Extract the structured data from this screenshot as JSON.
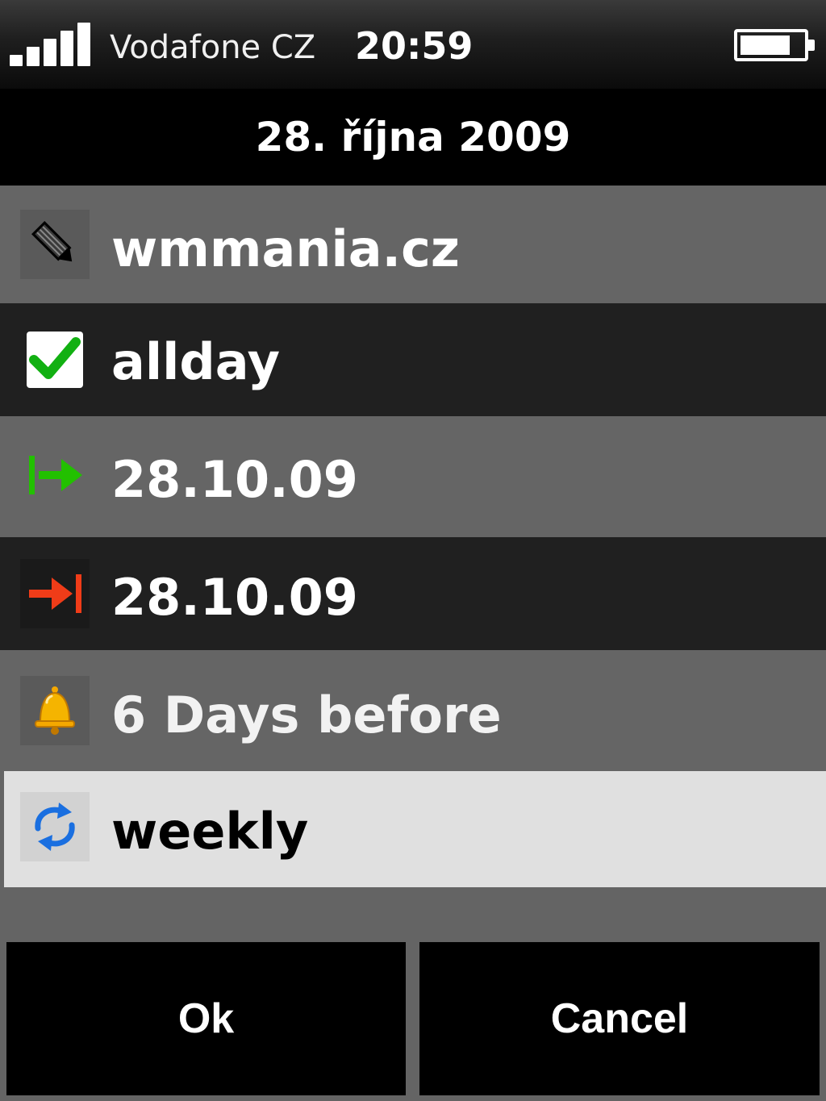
{
  "status_bar": {
    "carrier": "Vodafone CZ",
    "time": "20:59",
    "signal_bars": 5,
    "battery_level": 0.8
  },
  "header": {
    "date": "28. října 2009"
  },
  "fields": {
    "subject": "wmmania.cz",
    "allday": "allday",
    "allday_checked": true,
    "start": "28.10.09",
    "end": "28.10.09",
    "reminder": "6 Days before",
    "recurrence": "weekly"
  },
  "icons": {
    "subject": "pencil-icon",
    "allday": "checkmark-icon",
    "start": "start-arrow-icon",
    "end": "end-arrow-icon",
    "reminder": "bell-icon",
    "recurrence": "repeat-icon"
  },
  "colors": {
    "start_arrow": "#22c000",
    "end_arrow": "#f03c18",
    "check": "#12b012",
    "bell": "#f5a800",
    "repeat": "#1a6fe0",
    "selected_row": "#e0e0e0"
  },
  "buttons": {
    "ok": "Ok",
    "cancel": "Cancel"
  }
}
